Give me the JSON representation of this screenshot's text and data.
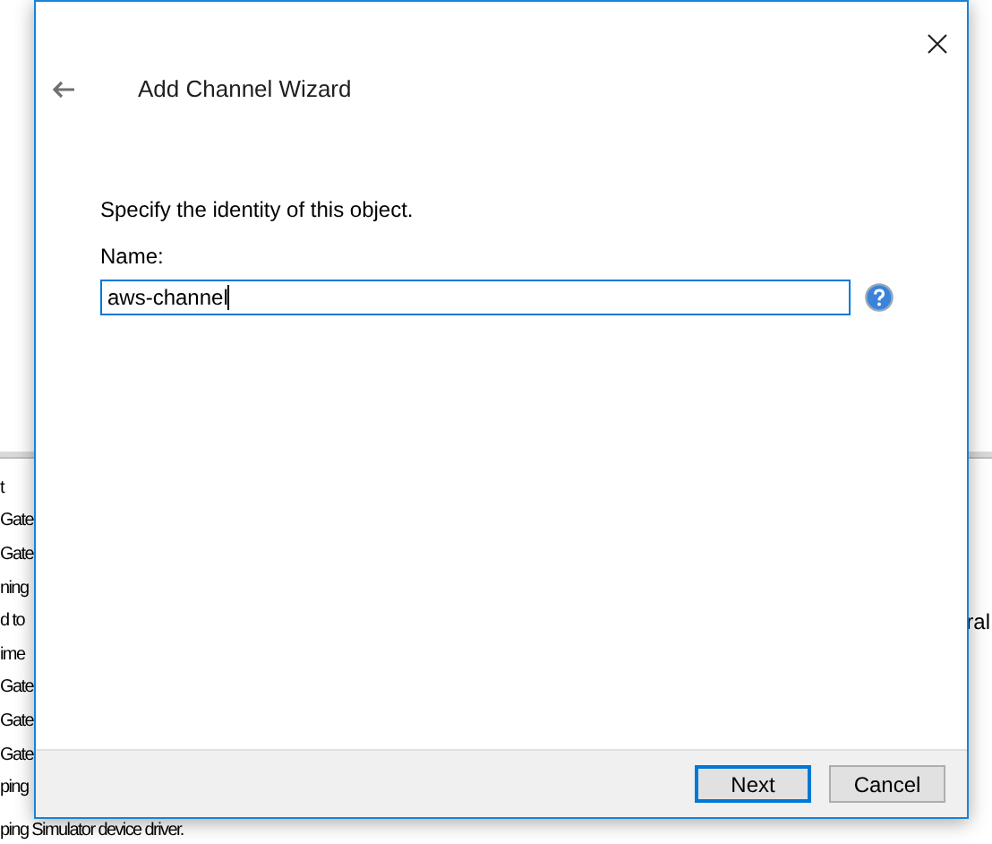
{
  "background_list": {
    "rows": [
      {
        "column_1": "t"
      },
      {
        "column_1": "Gate"
      },
      {
        "column_1": "Gate"
      },
      {
        "column_1": "ning"
      },
      {
        "column_1": "d to",
        "column_2": "ral"
      },
      {
        "column_1": "ime"
      },
      {
        "column_1": "Gate"
      },
      {
        "column_1": "Gate"
      },
      {
        "column_1": "Gate"
      },
      {
        "column_1": "ping"
      },
      {
        "column_1": "ping Simulator device driver."
      }
    ]
  },
  "dialog": {
    "title": "Add Channel Wizard",
    "instruction": "Specify the identity of this object.",
    "name_label": "Name:",
    "name_value": "aws-channel",
    "buttons": [
      {
        "label": "Next",
        "default": true
      },
      {
        "label": "Cancel",
        "default": false
      }
    ]
  }
}
